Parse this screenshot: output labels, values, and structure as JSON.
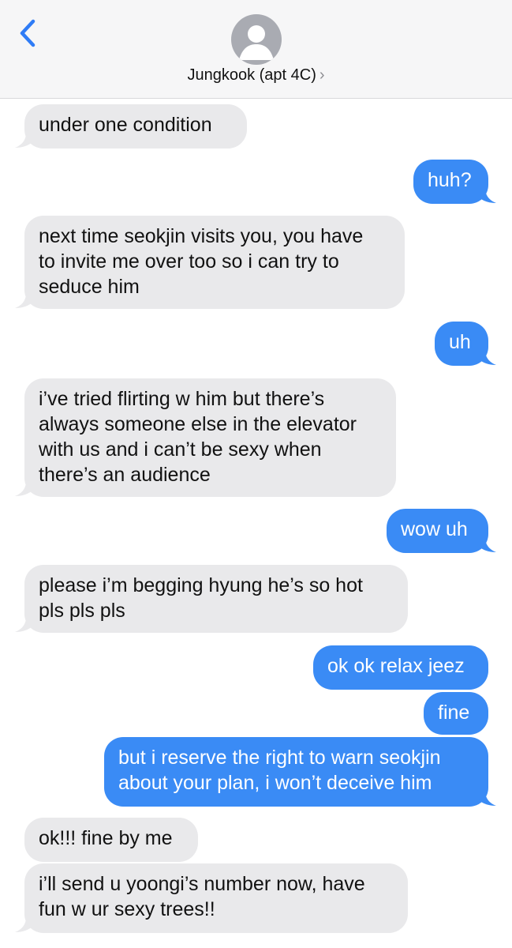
{
  "header": {
    "contact_name": "Jungkook (apt 4C)",
    "chevron": "›"
  },
  "colors": {
    "incoming_bubble": "#e9e9eb",
    "outgoing_bubble": "#3a8bf5",
    "accent": "#2f7cf6"
  },
  "messages": [
    {
      "dir": "in",
      "lines": [
        "under one condition"
      ]
    },
    {
      "dir": "out",
      "lines": [
        "huh?"
      ]
    },
    {
      "dir": "in",
      "lines": [
        "next time seokjin visits you, you have",
        "to invite me over too so i can try to",
        "seduce him"
      ]
    },
    {
      "dir": "out",
      "lines": [
        "uh"
      ]
    },
    {
      "dir": "in",
      "lines": [
        "i’ve tried flirting w him but there’s",
        "always someone else in the elevator",
        "with us and i can’t be sexy when",
        "there’s an audience"
      ]
    },
    {
      "dir": "out",
      "lines": [
        "wow uh"
      ]
    },
    {
      "dir": "in",
      "lines": [
        "please i’m begging hyung he’s so hot",
        "pls pls pls"
      ]
    },
    {
      "dir": "out",
      "lines": [
        "ok ok relax jeez"
      ]
    },
    {
      "dir": "out",
      "lines": [
        "fine"
      ]
    },
    {
      "dir": "out",
      "lines": [
        "but i reserve the right to warn seokjin",
        "about your plan, i won’t deceive him"
      ]
    },
    {
      "dir": "in",
      "lines": [
        "ok!!! fine by me"
      ]
    },
    {
      "dir": "in",
      "lines": [
        "i’ll send u yoongi’s number now, have",
        "fun w ur sexy trees!!"
      ]
    }
  ]
}
